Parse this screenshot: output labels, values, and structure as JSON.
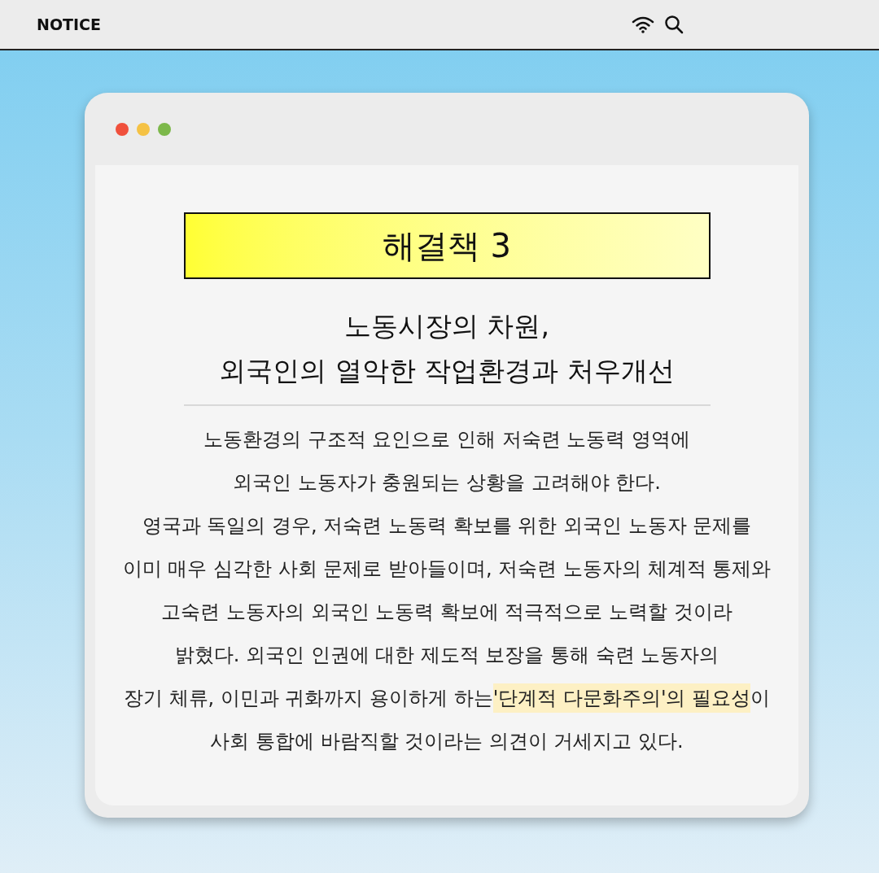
{
  "top_bar": {
    "title": "NOTICE"
  },
  "window": {
    "dots": [
      {
        "color": "#f0503c"
      },
      {
        "color": "#f5c244"
      },
      {
        "color": "#7cb84a"
      }
    ],
    "title_box": "해결책 3",
    "headline": [
      "노동시장의 차원,",
      "외국인의 열악한 작업환경과 처우개선"
    ],
    "body": [
      {
        "text": "노동환경의 구조적 요인으로 인해 저숙련 노동력 영역에"
      },
      {
        "text": "외국인 노동자가 충원되는 상황을 고려해야 한다."
      },
      {
        "text": "영국과 독일의 경우, 저숙련 노동력 확보를 위한 외국인 노동자 문제를"
      },
      {
        "text": "이미 매우 심각한 사회 문제로 받아들이며, 저숙련 노동자의 체계적 통제와"
      },
      {
        "text": "고숙련 노동자의 외국인 노동력 확보에 적극적으로 노력할 것이라"
      },
      {
        "text": "밝혔다. 외국인 인권에 대한 제도적 보장을 통해 숙련 노동자의"
      },
      {
        "text": "장기 체류, 이민과 귀화까지 용이하게 하는 ",
        "highlight": "'단계적 다문화주의'의 필요성",
        "after": "이"
      },
      {
        "text": "사회 통합에 바람직할 것이라는 의견이 거세지고 있다."
      }
    ]
  }
}
